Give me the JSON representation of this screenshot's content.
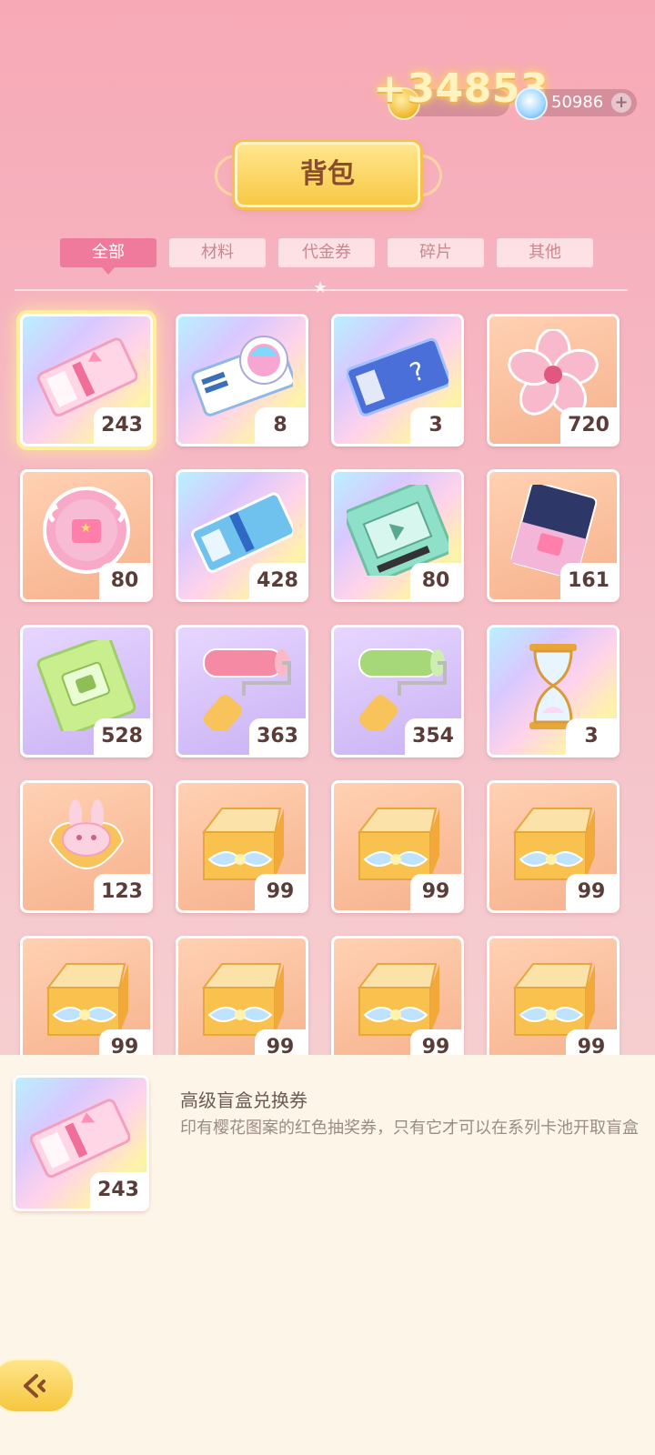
{
  "header": {
    "gain": "+34853",
    "coins_value": "",
    "gems_value": "50986",
    "gems_plus": "+",
    "title": "背包"
  },
  "tabs": [
    {
      "label": "全部",
      "active": true
    },
    {
      "label": "材料",
      "active": false
    },
    {
      "label": "代金券",
      "active": false
    },
    {
      "label": "碎片",
      "active": false
    },
    {
      "label": "其他",
      "active": false
    }
  ],
  "items": [
    {
      "icon": "pink-ticket-icon",
      "count": "243",
      "bg": "rainbow",
      "selected": true
    },
    {
      "icon": "avatar-ticket-icon",
      "count": "8",
      "bg": "rainbow"
    },
    {
      "icon": "mystery-ticket-icon",
      "count": "3",
      "bg": "rainbow"
    },
    {
      "icon": "sakura-flower-icon",
      "count": "720",
      "bg": "orange"
    },
    {
      "icon": "pink-coin-icon",
      "count": "80",
      "bg": "orange"
    },
    {
      "icon": "blue-ticket-icon",
      "count": "428",
      "bg": "rainbow"
    },
    {
      "icon": "video-ticket-icon",
      "count": "80",
      "bg": "rainbow"
    },
    {
      "icon": "dark-ticket-icon",
      "count": "161",
      "bg": "orange"
    },
    {
      "icon": "green-ticket-icon",
      "count": "528",
      "bg": "purple"
    },
    {
      "icon": "pink-roller-icon",
      "count": "363",
      "bg": "purple"
    },
    {
      "icon": "green-roller-icon",
      "count": "354",
      "bg": "purple"
    },
    {
      "icon": "hourglass-icon",
      "count": "3",
      "bg": "rainbow"
    },
    {
      "icon": "bunny-pouch-icon",
      "count": "123",
      "bg": "orange"
    },
    {
      "icon": "gift-box-icon",
      "count": "99",
      "bg": "orange"
    },
    {
      "icon": "gift-box-icon",
      "count": "99",
      "bg": "orange"
    },
    {
      "icon": "gift-box-icon",
      "count": "99",
      "bg": "orange"
    },
    {
      "icon": "gift-box-icon",
      "count": "99",
      "bg": "orange"
    },
    {
      "icon": "gift-box-icon",
      "count": "99",
      "bg": "orange"
    },
    {
      "icon": "gift-box-icon",
      "count": "99",
      "bg": "orange"
    },
    {
      "icon": "gift-box-icon",
      "count": "99",
      "bg": "orange"
    }
  ],
  "detail": {
    "name": "高级盲盒兑换券",
    "description": "印有樱花图案的红色抽奖券，只有它才可以在系列卡池开取盲盒",
    "count": "243"
  }
}
